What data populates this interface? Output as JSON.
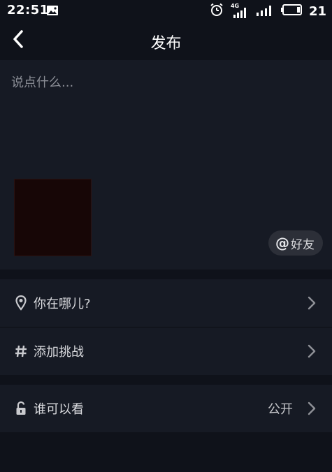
{
  "status_bar": {
    "time": "22:51",
    "network_label": "4G",
    "battery_level": "21",
    "icons": [
      "image-notification-icon",
      "alarm-icon",
      "signal-4g-icon",
      "signal-icon",
      "battery-icon"
    ]
  },
  "header": {
    "title": "发布",
    "back_icon": "chevron-left-icon"
  },
  "compose": {
    "placeholder": "说点什么...",
    "value": "",
    "mention_symbol": "@",
    "mention_label": "好友"
  },
  "options": {
    "location": {
      "label": "你在哪儿?",
      "icon": "location-pin-icon"
    },
    "challenge": {
      "label": "添加挑战",
      "icon": "hashtag-icon"
    },
    "visibility": {
      "label": "谁可以看",
      "value": "公开",
      "icon": "unlock-icon"
    }
  },
  "colors": {
    "background": "#0f121a",
    "panel": "#161a24",
    "pill": "#2c2f38",
    "muted_text": "#8a8d95"
  }
}
